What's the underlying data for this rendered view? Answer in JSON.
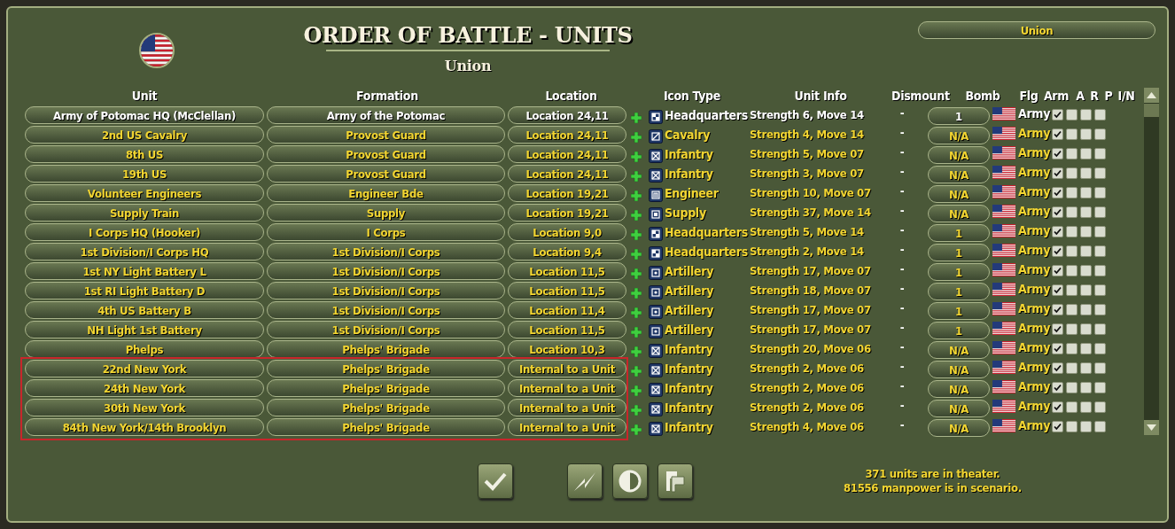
{
  "title": "ORDER OF BATTLE - UNITS",
  "subtitle": "Union",
  "side_button": "Union",
  "columns": [
    "Unit",
    "Formation",
    "Location",
    "Icon Type",
    "Unit Info",
    "Dismount",
    "Bomb",
    "Flg",
    "Arm",
    "A",
    "R",
    "P",
    "I/N"
  ],
  "table": {
    "rows": [
      {
        "unit": "Army of Potomac HQ (McClellan)",
        "formation": "Army of the Potomac",
        "location": "Location 24,11",
        "kind": "headquarters",
        "icon_type": "Headquarters",
        "unit_info": "Strength 6, Move 14",
        "dismount": "-",
        "bomb": "1",
        "arm": "Army",
        "a": true,
        "r": false,
        "p": false,
        "i_n": false,
        "selected": true
      },
      {
        "unit": "2nd US Cavalry",
        "formation": "Provost Guard",
        "location": "Location 24,11",
        "kind": "cavalry",
        "icon_type": "Cavalry",
        "unit_info": "Strength 4, Move 14",
        "dismount": "-",
        "bomb": "N/A",
        "arm": "Army",
        "a": true,
        "r": false,
        "p": false,
        "i_n": false,
        "selected": false
      },
      {
        "unit": "8th US",
        "formation": "Provost Guard",
        "location": "Location 24,11",
        "kind": "infantry",
        "icon_type": "Infantry",
        "unit_info": "Strength 5, Move 07",
        "dismount": "-",
        "bomb": "N/A",
        "arm": "Army",
        "a": true,
        "r": false,
        "p": false,
        "i_n": false,
        "selected": false
      },
      {
        "unit": "19th US",
        "formation": "Provost Guard",
        "location": "Location 24,11",
        "kind": "infantry",
        "icon_type": "Infantry",
        "unit_info": "Strength 3, Move 07",
        "dismount": "-",
        "bomb": "N/A",
        "arm": "Army",
        "a": true,
        "r": false,
        "p": false,
        "i_n": false,
        "selected": false
      },
      {
        "unit": "Volunteer Engineers",
        "formation": "Engineer Bde",
        "location": "Location 19,21",
        "kind": "engineer",
        "icon_type": "Engineer",
        "unit_info": "Strength 10, Move 07",
        "dismount": "-",
        "bomb": "N/A",
        "arm": "Army",
        "a": true,
        "r": false,
        "p": false,
        "i_n": false,
        "selected": false
      },
      {
        "unit": "Supply Train",
        "formation": "Supply",
        "location": "Location 19,21",
        "kind": "supply",
        "icon_type": "Supply",
        "unit_info": "Strength 37, Move 14",
        "dismount": "-",
        "bomb": "N/A",
        "arm": "Army",
        "a": true,
        "r": false,
        "p": false,
        "i_n": false,
        "selected": false
      },
      {
        "unit": "I Corps HQ (Hooker)",
        "formation": "I Corps",
        "location": "Location 9,0",
        "kind": "headquarters",
        "icon_type": "Headquarters",
        "unit_info": "Strength 5, Move 14",
        "dismount": "-",
        "bomb": "1",
        "arm": "Army",
        "a": true,
        "r": false,
        "p": false,
        "i_n": false,
        "selected": false
      },
      {
        "unit": "1st Division/I Corps HQ",
        "formation": "1st Division/I Corps",
        "location": "Location 9,4",
        "kind": "headquarters",
        "icon_type": "Headquarters",
        "unit_info": "Strength 2, Move 14",
        "dismount": "-",
        "bomb": "1",
        "arm": "Army",
        "a": true,
        "r": false,
        "p": false,
        "i_n": false,
        "selected": false
      },
      {
        "unit": "1st NY Light Battery L",
        "formation": "1st Division/I Corps",
        "location": "Location 11,5",
        "kind": "artillery",
        "icon_type": "Artillery",
        "unit_info": "Strength 17, Move 07",
        "dismount": "-",
        "bomb": "1",
        "arm": "Army",
        "a": true,
        "r": false,
        "p": false,
        "i_n": false,
        "selected": false
      },
      {
        "unit": "1st RI Light Battery D",
        "formation": "1st Division/I Corps",
        "location": "Location 11,5",
        "kind": "artillery",
        "icon_type": "Artillery",
        "unit_info": "Strength 18, Move 07",
        "dismount": "-",
        "bomb": "1",
        "arm": "Army",
        "a": true,
        "r": false,
        "p": false,
        "i_n": false,
        "selected": false
      },
      {
        "unit": "4th US Battery B",
        "formation": "1st Division/I Corps",
        "location": "Location 11,4",
        "kind": "artillery",
        "icon_type": "Artillery",
        "unit_info": "Strength 17, Move 07",
        "dismount": "-",
        "bomb": "1",
        "arm": "Army",
        "a": true,
        "r": false,
        "p": false,
        "i_n": false,
        "selected": false
      },
      {
        "unit": "NH Light 1st Battery",
        "formation": "1st Division/I Corps",
        "location": "Location 11,5",
        "kind": "artillery",
        "icon_type": "Artillery",
        "unit_info": "Strength 17, Move 07",
        "dismount": "-",
        "bomb": "1",
        "arm": "Army",
        "a": true,
        "r": false,
        "p": false,
        "i_n": false,
        "selected": false
      },
      {
        "unit": "Phelps",
        "formation": "Phelps' Brigade",
        "location": "Location 10,3",
        "kind": "infantry",
        "icon_type": "Infantry",
        "unit_info": "Strength 20, Move 06",
        "dismount": "-",
        "bomb": "N/A",
        "arm": "Army",
        "a": true,
        "r": false,
        "p": false,
        "i_n": false,
        "selected": false
      }
    ],
    "outlined_rows": [
      {
        "unit": "22nd New York",
        "formation": "Phelps' Brigade",
        "location": "Internal to a Unit",
        "kind": "infantry",
        "icon_type": "Infantry",
        "unit_info": "Strength 2, Move 06",
        "dismount": "-",
        "bomb": "N/A",
        "arm": "Army",
        "a": true,
        "r": false,
        "p": false,
        "i_n": false,
        "selected": false
      },
      {
        "unit": "24th New York",
        "formation": "Phelps' Brigade",
        "location": "Internal to a Unit",
        "kind": "infantry",
        "icon_type": "Infantry",
        "unit_info": "Strength 2, Move 06",
        "dismount": "-",
        "bomb": "N/A",
        "arm": "Army",
        "a": true,
        "r": false,
        "p": false,
        "i_n": false,
        "selected": false
      },
      {
        "unit": "30th New York",
        "formation": "Phelps' Brigade",
        "location": "Internal to a Unit",
        "kind": "infantry",
        "icon_type": "Infantry",
        "unit_info": "Strength 2, Move 06",
        "dismount": "-",
        "bomb": "N/A",
        "arm": "Army",
        "a": true,
        "r": false,
        "p": false,
        "i_n": false,
        "selected": false
      },
      {
        "unit": "84th New York/14th Brooklyn",
        "formation": "Phelps' Brigade",
        "location": "Internal to a Unit",
        "kind": "infantry",
        "icon_type": "Infantry",
        "unit_info": "Strength 4, Move 06",
        "dismount": "-",
        "bomb": "N/A",
        "arm": "Army",
        "a": true,
        "r": false,
        "p": false,
        "i_n": false,
        "selected": false
      }
    ]
  },
  "status": [
    "371 units are in theater.",
    "81556 manpower is in scenario."
  ]
}
